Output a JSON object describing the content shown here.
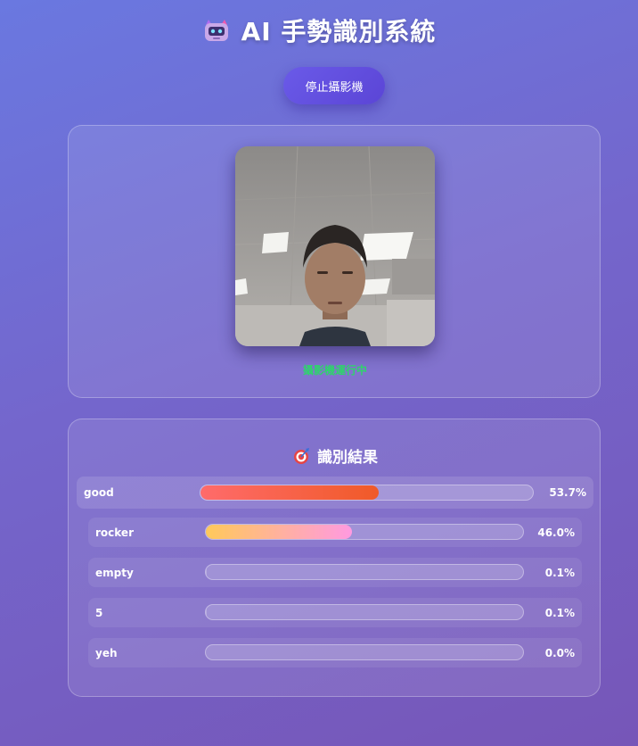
{
  "header": {
    "title": "AI 手勢識別系統",
    "icon": "robot-icon"
  },
  "controls": {
    "stop_label": "停止攝影機"
  },
  "camera": {
    "status": "攝影機運行中",
    "status_color": "#2fd36c"
  },
  "results": {
    "title": "識別結果",
    "icon": "target-icon",
    "items": [
      {
        "label": "good",
        "percent_text": "53.7%",
        "value": 0.537
      },
      {
        "label": "rocker",
        "percent_text": "46.0%",
        "value": 0.46
      },
      {
        "label": "empty",
        "percent_text": "0.1%",
        "value": 0.001
      },
      {
        "label": "5",
        "percent_text": "0.1%",
        "value": 0.001
      },
      {
        "label": "yeh",
        "percent_text": "0.0%",
        "value": 0.0
      }
    ]
  }
}
